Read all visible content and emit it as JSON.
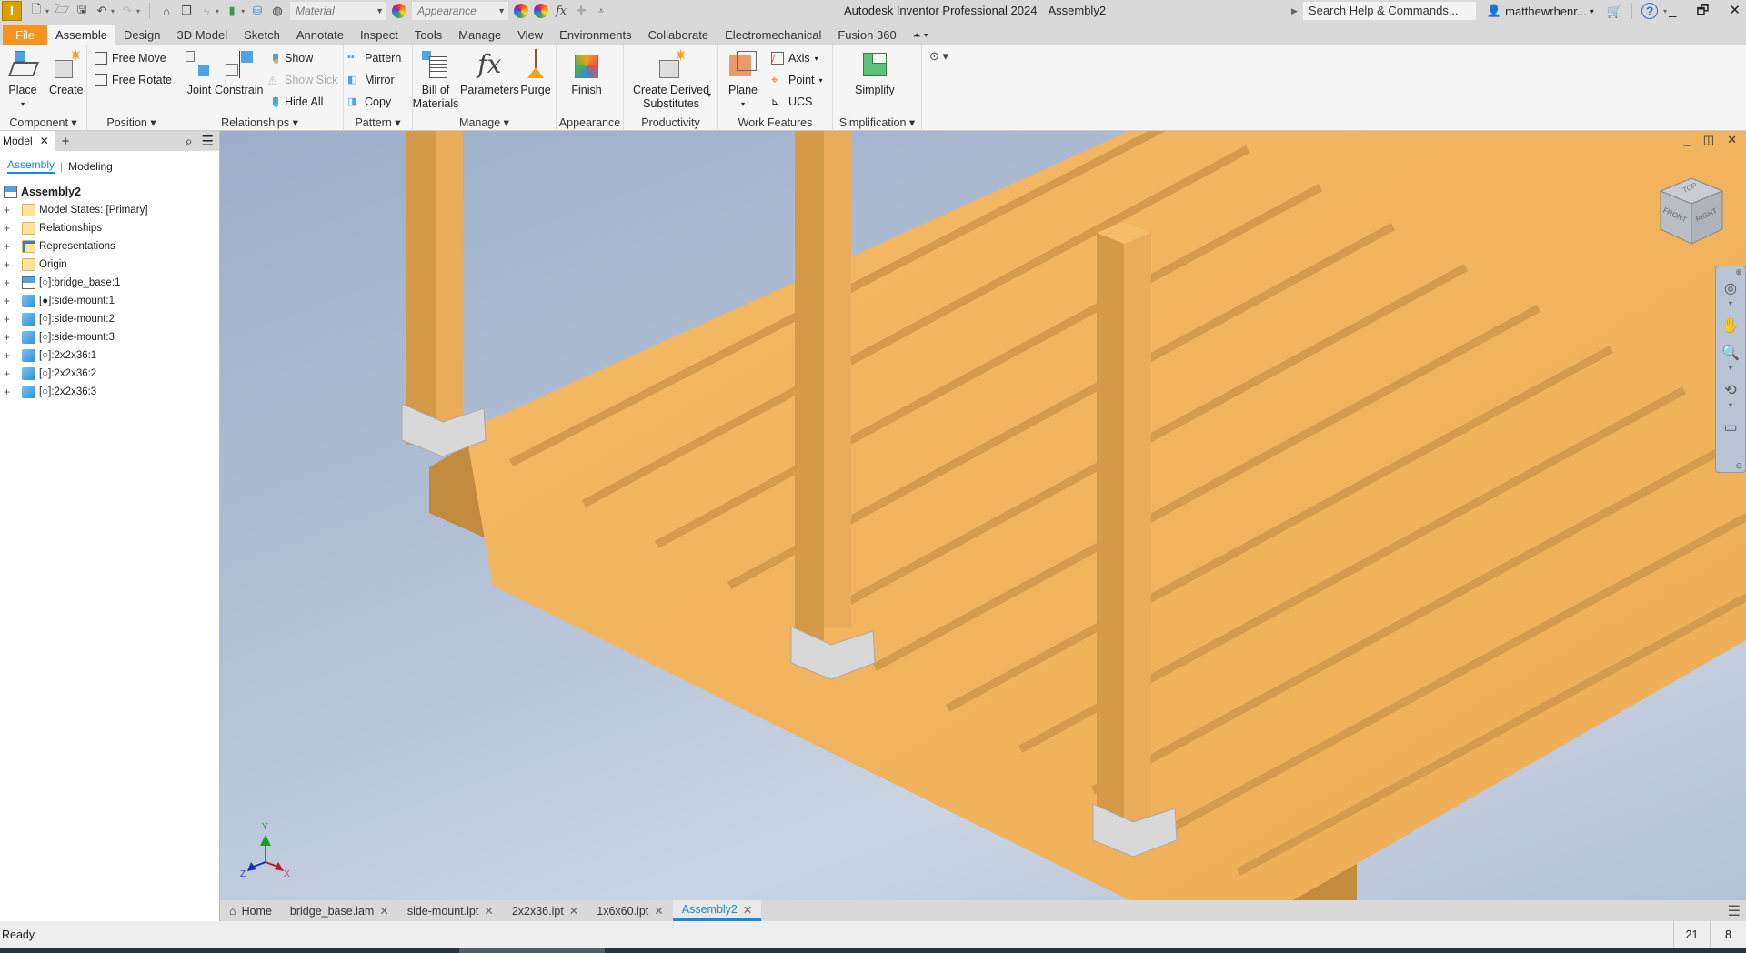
{
  "window": {
    "app_title": "Autodesk Inventor Professional 2024",
    "document_title": "Assembly2",
    "logo_letter": "I",
    "controls": {
      "minimize": "_",
      "restore": "🗗",
      "close": "✕"
    }
  },
  "quick_access": {
    "material_placeholder": "Material",
    "appearance_placeholder": "Appearance"
  },
  "search": {
    "placeholder": "Search Help & Commands..."
  },
  "user": {
    "name": "matthewrhenr..."
  },
  "menu_tabs": [
    "File",
    "Assemble",
    "Design",
    "3D Model",
    "Sketch",
    "Annotate",
    "Inspect",
    "Tools",
    "Manage",
    "View",
    "Environments",
    "Collaborate",
    "Electromechanical",
    "Fusion 360"
  ],
  "active_menu_tab": "Assemble",
  "ribbon": {
    "component": {
      "label": "Component ▾",
      "place": "Place",
      "create": "Create"
    },
    "position": {
      "label": "Position ▾",
      "free_move": "Free Move",
      "free_rotate": "Free Rotate"
    },
    "relationships": {
      "label": "Relationships ▾",
      "joint": "Joint",
      "constrain": "Constrain",
      "show": "Show",
      "show_sick": "Show Sick",
      "hide_all": "Hide All"
    },
    "pattern": {
      "label": "Pattern ▾",
      "pattern": "Pattern",
      "mirror": "Mirror",
      "copy": "Copy"
    },
    "manage": {
      "label": "Manage ▾",
      "bom_line1": "Bill of",
      "bom_line2": "Materials",
      "parameters": "Parameters",
      "purge": "Purge"
    },
    "appearance": {
      "label": "Appearance",
      "finish": "Finish"
    },
    "productivity": {
      "label": "Productivity",
      "derived_line1": "Create Derived",
      "derived_line2": "Substitutes"
    },
    "work_features": {
      "label": "Work Features",
      "plane": "Plane",
      "axis": "Axis",
      "point": "Point",
      "ucs": "UCS"
    },
    "simplification": {
      "label": "Simplification ▾",
      "simplify": "Simplify"
    }
  },
  "browser": {
    "tab_label": "Model",
    "subtabs": {
      "assembly": "Assembly",
      "modeling": "Modeling"
    },
    "root": "Assembly2",
    "nodes": [
      {
        "label": "Model States: [Primary]",
        "icon": "folder"
      },
      {
        "label": "Relationships",
        "icon": "folder"
      },
      {
        "label": "Representations",
        "icon": "representations"
      },
      {
        "label": "Origin",
        "icon": "folder"
      },
      {
        "label": "[○]:bridge_base:1",
        "icon": "assembly"
      },
      {
        "label": "[●]:side-mount:1",
        "icon": "part"
      },
      {
        "label": "[○]:side-mount:2",
        "icon": "part"
      },
      {
        "label": "[○]:side-mount:3",
        "icon": "part"
      },
      {
        "label": "[○]:2x2x36:1",
        "icon": "part"
      },
      {
        "label": "[○]:2x2x36:2",
        "icon": "part"
      },
      {
        "label": "[○]:2x2x36:3",
        "icon": "part"
      }
    ]
  },
  "viewcube": {
    "top": "TOP",
    "front": "FRONT",
    "right": "RIGHT"
  },
  "triad": {
    "x": "X",
    "y": "Y",
    "z": "Z"
  },
  "doc_tabs": [
    {
      "label": "Home",
      "closable": false
    },
    {
      "label": "bridge_base.iam",
      "closable": true
    },
    {
      "label": "side-mount.ipt",
      "closable": true
    },
    {
      "label": "2x2x36.ipt",
      "closable": true
    },
    {
      "label": "1x6x60.ipt",
      "closable": true
    },
    {
      "label": "Assembly2",
      "closable": true,
      "active": true
    }
  ],
  "status": {
    "text": "Ready",
    "cell1": "21",
    "cell2": "8"
  },
  "colors": {
    "file_tab": "#f7941d",
    "accent": "#1a8ad4",
    "wood": "#f2b561",
    "wood_dark": "#d49a48",
    "bracket": "#d9d9d9"
  }
}
